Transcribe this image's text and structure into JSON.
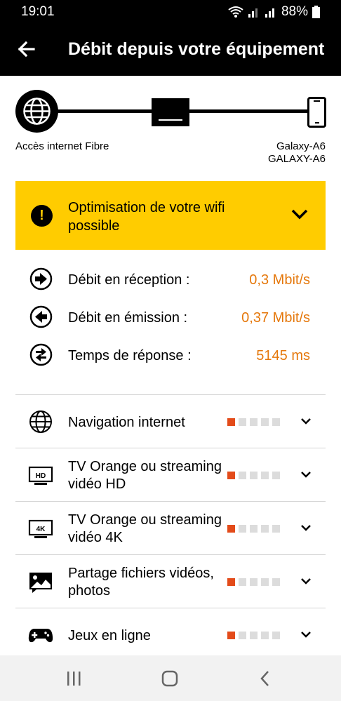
{
  "status_bar": {
    "time": "19:01",
    "battery": "88%"
  },
  "app_bar": {
    "title": "Débit depuis votre équipement"
  },
  "diagram": {
    "source_label": "Accès internet Fibre",
    "device_name": "Galaxy-A6",
    "device_model": "GALAXY-A6"
  },
  "warning": {
    "text": "Optimisation de votre wifi possible"
  },
  "metrics": [
    {
      "label": "Débit en réception :",
      "value": "0,3 Mbit/s",
      "icon": "arrow-right-circle-icon"
    },
    {
      "label": "Débit en émission :",
      "value": "0,37 Mbit/s",
      "icon": "arrow-left-circle-icon"
    },
    {
      "label": "Temps de réponse :",
      "value": "5145 ms",
      "icon": "swap-arrows-circle-icon"
    }
  ],
  "uses": [
    {
      "label": "Navigation internet",
      "icon": "globe-icon",
      "level": 1,
      "max": 5
    },
    {
      "label": "TV Orange ou streaming vidéo HD",
      "icon": "hd-tv-icon",
      "level": 1,
      "max": 5
    },
    {
      "label": "TV Orange ou streaming vidéo 4K",
      "icon": "4k-tv-icon",
      "level": 1,
      "max": 5
    },
    {
      "label": "Partage fichiers vidéos, photos",
      "icon": "image-share-icon",
      "level": 1,
      "max": 5
    },
    {
      "label": "Jeux en ligne",
      "icon": "gamepad-icon",
      "level": 1,
      "max": 5
    }
  ],
  "colors": {
    "accent": "#e5780c",
    "warning_bg": "#ffcc00",
    "level_on": "#e34b1a",
    "level_off": "#dcdcdc"
  },
  "nav_bar": {
    "icons": [
      "recent-apps-icon",
      "home-icon",
      "back-nav-icon"
    ]
  }
}
